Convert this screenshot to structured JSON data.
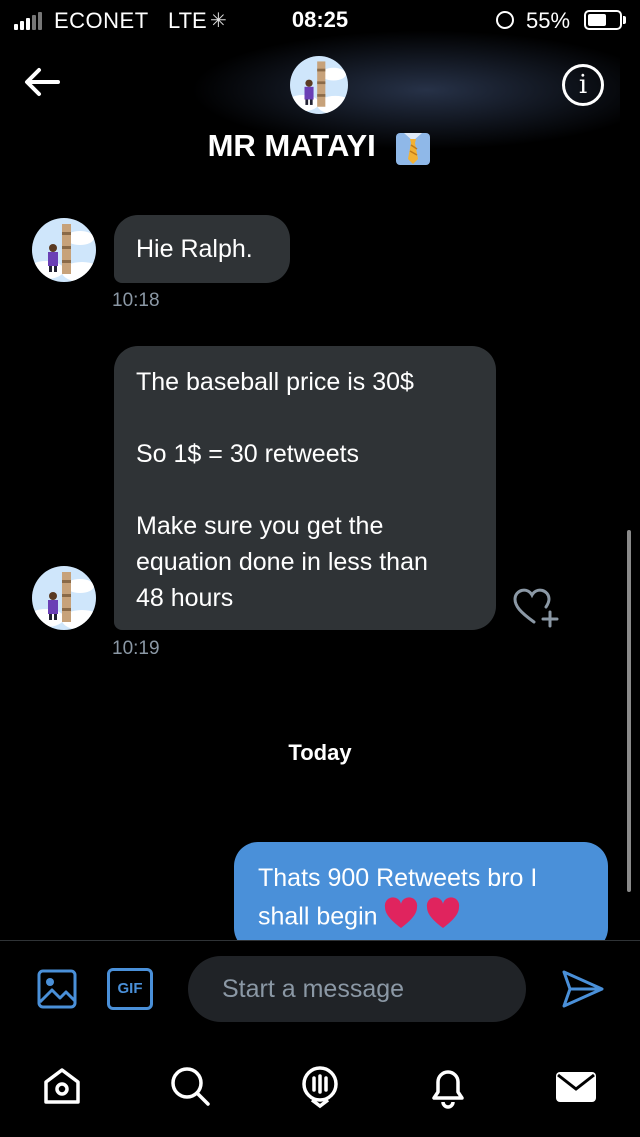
{
  "status_bar": {
    "carrier": "ECONET",
    "network": "LTE",
    "time": "08:25",
    "battery": "55%",
    "battery_level": 0.55
  },
  "header": {
    "title": "MR MATAYI",
    "title_emoji_icon": "necktie-icon"
  },
  "messages": [
    {
      "from": "them",
      "lines": [
        "Hie Ralph."
      ],
      "time": "10:18"
    },
    {
      "from": "them",
      "paragraphs": [
        "The baseball price is 30$",
        "So 1$ = 30 retweets",
        "Make sure you get the",
        "equation done in less than",
        "48 hours"
      ],
      "time": "10:19"
    }
  ],
  "divider": "Today",
  "my_message": {
    "line1": "Thats 900 Retweets bro I",
    "line2": "shall begin"
  },
  "composer": {
    "placeholder": "Start a message",
    "gif_label": "GIF"
  },
  "colors": {
    "accent": "#4a90d9",
    "bubble_them": "#2f3336",
    "timestamp": "#8b98a5",
    "heart": "#e0245e"
  },
  "tabs": [
    "home-icon",
    "search-icon",
    "spaces-icon",
    "notifications-icon",
    "messages-icon"
  ]
}
